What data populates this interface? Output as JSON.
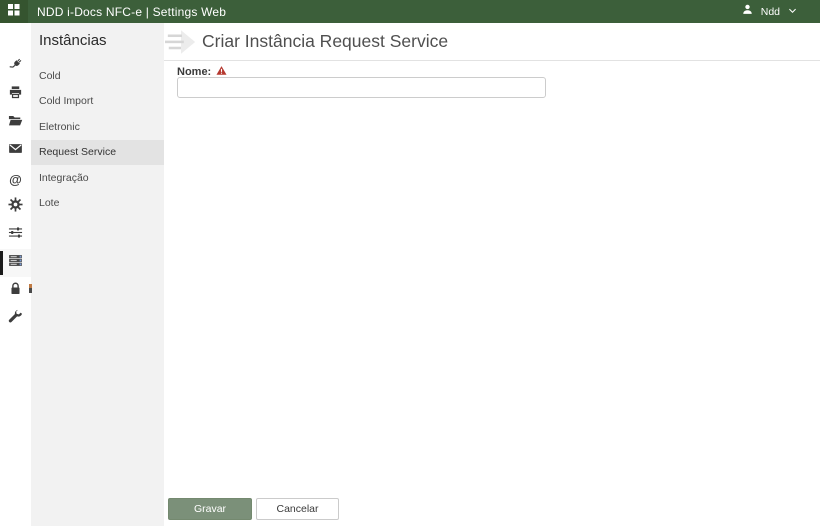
{
  "topbar": {
    "app_title": "NDD i-Docs NFC-e | Settings Web",
    "user_name": "Ndd"
  },
  "icon_rail": {
    "at_symbol": "@",
    "items": [
      {
        "name": "plug",
        "selected": false
      },
      {
        "name": "printer",
        "selected": false
      },
      {
        "name": "folder",
        "selected": false
      },
      {
        "name": "mail",
        "selected": false
      },
      {
        "name": "at",
        "selected": false
      },
      {
        "name": "gear",
        "selected": false
      },
      {
        "name": "sliders",
        "selected": false
      },
      {
        "name": "instances",
        "selected": true
      },
      {
        "name": "lock",
        "selected": false
      },
      {
        "name": "wrench",
        "selected": false
      }
    ]
  },
  "sidebar": {
    "title": "Instâncias",
    "items": [
      {
        "label": "Cold",
        "selected": false
      },
      {
        "label": "Cold Import",
        "selected": false
      },
      {
        "label": "Eletronic",
        "selected": false
      },
      {
        "label": "Request Service",
        "selected": true
      },
      {
        "label": "Integração",
        "selected": false
      },
      {
        "label": "Lote",
        "selected": false
      }
    ]
  },
  "main": {
    "title": "Criar Instância Request Service",
    "form": {
      "name_label": "Nome:",
      "name_value": "",
      "name_placeholder": ""
    },
    "actions": {
      "save_label": "Gravar",
      "cancel_label": "Cancelar"
    }
  },
  "colors": {
    "topbar_bg": "#3c5f3a",
    "save_button_bg": "#7b9079",
    "warning_red": "#b5382f",
    "sidebar_bg": "#f2f2f2",
    "selected_item_bg": "#e3e3e3"
  }
}
